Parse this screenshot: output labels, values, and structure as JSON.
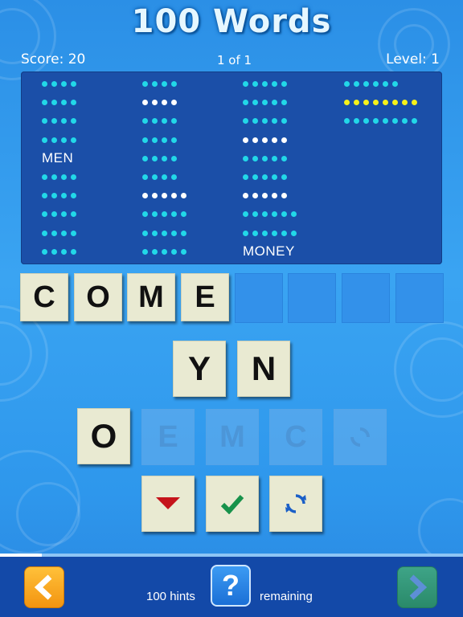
{
  "header": {
    "title": "100 Words",
    "score": "Score: 20",
    "page": "1 of 1",
    "level": "Level: 1"
  },
  "word_columns": [
    {
      "rows": [
        {
          "word": "",
          "dots": 4,
          "color": "cyan"
        },
        {
          "word": "",
          "dots": 4,
          "color": "cyan"
        },
        {
          "word": "",
          "dots": 4,
          "color": "cyan"
        },
        {
          "word": "",
          "dots": 4,
          "color": "cyan"
        },
        {
          "word": "MEN",
          "dots": 0,
          "color": ""
        },
        {
          "word": "",
          "dots": 4,
          "color": "cyan"
        },
        {
          "word": "",
          "dots": 4,
          "color": "cyan"
        },
        {
          "word": "",
          "dots": 4,
          "color": "cyan"
        },
        {
          "word": "",
          "dots": 4,
          "color": "cyan"
        },
        {
          "word": "",
          "dots": 4,
          "color": "cyan"
        }
      ]
    },
    {
      "rows": [
        {
          "word": "",
          "dots": 4,
          "color": "cyan"
        },
        {
          "word": "",
          "dots": 4,
          "color": "white"
        },
        {
          "word": "",
          "dots": 4,
          "color": "cyan"
        },
        {
          "word": "",
          "dots": 4,
          "color": "cyan"
        },
        {
          "word": "",
          "dots": 4,
          "color": "cyan"
        },
        {
          "word": "",
          "dots": 4,
          "color": "cyan"
        },
        {
          "word": "",
          "dots": 5,
          "color": "white"
        },
        {
          "word": "",
          "dots": 5,
          "color": "cyan"
        },
        {
          "word": "",
          "dots": 5,
          "color": "cyan"
        },
        {
          "word": "",
          "dots": 5,
          "color": "cyan"
        }
      ]
    },
    {
      "rows": [
        {
          "word": "",
          "dots": 5,
          "color": "cyan"
        },
        {
          "word": "",
          "dots": 5,
          "color": "cyan"
        },
        {
          "word": "",
          "dots": 5,
          "color": "cyan"
        },
        {
          "word": "",
          "dots": 5,
          "color": "white"
        },
        {
          "word": "",
          "dots": 5,
          "color": "cyan"
        },
        {
          "word": "",
          "dots": 5,
          "color": "cyan"
        },
        {
          "word": "",
          "dots": 5,
          "color": "white"
        },
        {
          "word": "",
          "dots": 6,
          "color": "cyan"
        },
        {
          "word": "",
          "dots": 6,
          "color": "cyan"
        },
        {
          "word": "MONEY",
          "dots": 0,
          "color": ""
        }
      ]
    },
    {
      "rows": [
        {
          "word": "",
          "dots": 6,
          "color": "cyan"
        },
        {
          "word": "",
          "dots": 8,
          "color": "yellow"
        },
        {
          "word": "",
          "dots": 8,
          "color": "cyan"
        }
      ]
    }
  ],
  "answer_slots": [
    "C",
    "O",
    "M",
    "E",
    "",
    "",
    "",
    ""
  ],
  "available_letters": {
    "row1": [
      "Y",
      "N"
    ],
    "row2": [
      "O"
    ],
    "used_ghosts": [
      "E",
      "M",
      "C"
    ]
  },
  "controls": {
    "clear_icon": "down-triangle-icon",
    "submit_icon": "checkmark-icon",
    "shuffle_icon": "refresh-icon"
  },
  "progress": {
    "fraction": 0.09
  },
  "footer": {
    "hints_count": "100 hints",
    "help_label": "?",
    "remaining_label": "remaining",
    "back_icon": "chevron-left-icon",
    "next_icon": "chevron-right-icon"
  },
  "colors": {
    "cyan": "#22d8e8",
    "white": "#ffffff",
    "yellow": "#f6f21a",
    "orange": "#f7a21a",
    "green": "#2e9a6f"
  }
}
